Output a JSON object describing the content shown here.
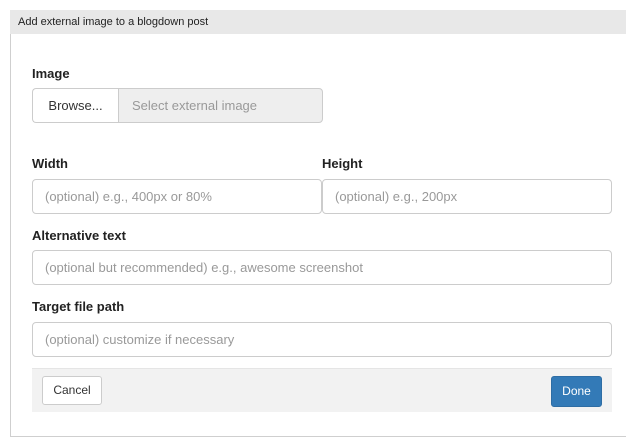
{
  "dialog": {
    "title": "Add external image to a blogdown post"
  },
  "image": {
    "label": "Image",
    "browse_label": "Browse...",
    "file_placeholder": "Select external image"
  },
  "width": {
    "label": "Width",
    "placeholder": "(optional) e.g., 400px or 80%",
    "value": ""
  },
  "height": {
    "label": "Height",
    "placeholder": "(optional) e.g., 200px",
    "value": ""
  },
  "alt_text": {
    "label": "Alternative text",
    "placeholder": "(optional but recommended) e.g., awesome screenshot",
    "value": ""
  },
  "target_path": {
    "label": "Target file path",
    "placeholder": "(optional) customize if necessary",
    "value": ""
  },
  "footer": {
    "cancel_label": "Cancel",
    "done_label": "Done"
  },
  "colors": {
    "primary": "#337ab7",
    "titlebar_bg": "#e8e8e8",
    "footer_bg": "#f2f2f2",
    "disabled_field_bg": "#eeeeee"
  }
}
